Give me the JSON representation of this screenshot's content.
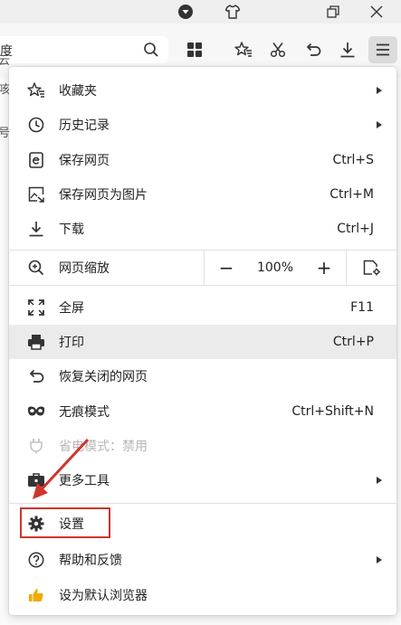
{
  "toolbar": {
    "search_fragment": "度"
  },
  "page_behind": {
    "fragments": [
      "咳",
      "云",
      "号为"
    ]
  },
  "menu": {
    "items": [
      {
        "label": "收藏夹",
        "icon": "favorites-star-icon",
        "submenu": true
      },
      {
        "label": "历史记录",
        "icon": "history-clock-icon",
        "submenu": true
      },
      {
        "label": "保存网页",
        "icon": "save-page-icon",
        "shortcut": "Ctrl+S"
      },
      {
        "label": "保存网页为图片",
        "icon": "save-image-icon",
        "shortcut": "Ctrl+M"
      },
      {
        "label": "下载",
        "icon": "download-icon",
        "shortcut": "Ctrl+J"
      },
      {
        "label": "全屏",
        "icon": "fullscreen-icon",
        "shortcut": "F11"
      },
      {
        "label": "打印",
        "icon": "printer-icon",
        "shortcut": "Ctrl+P",
        "hover": true
      },
      {
        "label": "恢复关闭的网页",
        "icon": "undo-icon"
      },
      {
        "label": "无痕模式",
        "icon": "incognito-mask-icon",
        "shortcut": "Ctrl+Shift+N"
      },
      {
        "label": "省电模式：禁用",
        "icon": "power-plug-icon",
        "disabled": true
      },
      {
        "label": "更多工具",
        "icon": "toolbox-icon",
        "submenu": true
      },
      {
        "label": "设置",
        "icon": "gear-icon",
        "highlighted": true
      },
      {
        "label": "帮助和反馈",
        "icon": "help-circle-icon",
        "submenu": true
      },
      {
        "label": "设为默认浏览器",
        "icon": "thumbs-up-icon"
      }
    ],
    "zoom": {
      "label": "网页缩放",
      "minus": "−",
      "value": "100%",
      "plus": "+"
    }
  },
  "colors": {
    "annotation": "#d0342c",
    "hover_bg": "#ebebeb"
  }
}
